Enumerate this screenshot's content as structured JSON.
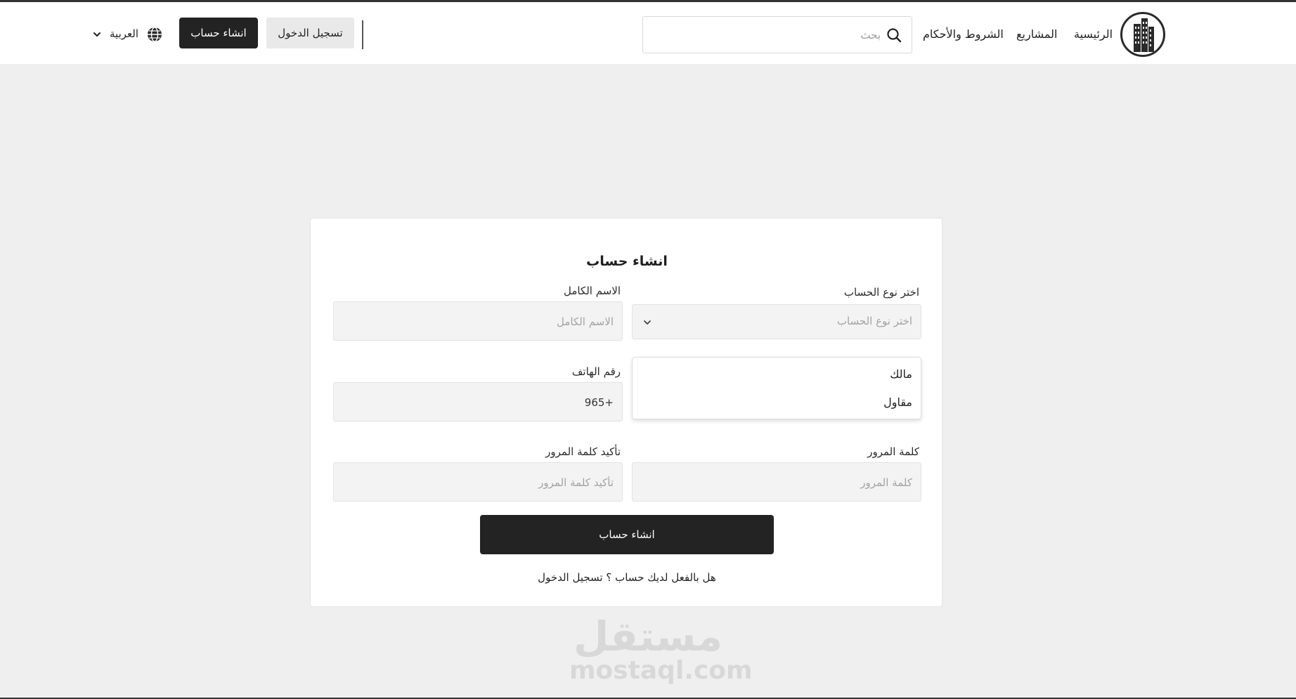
{
  "nav": {
    "links": [
      "الرئيسية",
      "المشاريع",
      "الشروط والأحكام"
    ],
    "search_placeholder": "بحث",
    "login_label": "تسجيل الدخول",
    "signup_label": "انشاء حساب",
    "language_label": "العربية"
  },
  "form": {
    "title": "انشاء حساب",
    "account_type": {
      "label": "اختر نوع الحساب",
      "placeholder": "اختر نوع الحساب",
      "options": [
        "مالك",
        "مقاول"
      ]
    },
    "full_name": {
      "label": "الاسم الكامل",
      "placeholder": "الاسم الكامل"
    },
    "phone": {
      "label": "رقم الهاتف",
      "value": "+965"
    },
    "password": {
      "label": "كلمة المرور",
      "placeholder": "كلمة المرور"
    },
    "confirm_password": {
      "label": "تأكيد كلمة المرور",
      "placeholder": "تأكيد كلمة المرور"
    },
    "submit_label": "انشاء حساب",
    "already_prompt": "هل بالفعل لديك حساب ؟",
    "already_link": "تسجيل الدخول"
  },
  "watermark": {
    "arabic": "مستقل",
    "latin": "mostaql.com"
  },
  "colors": {
    "page_bg": "#efefef",
    "primary_dark": "#232323",
    "card_bg": "#ffffff",
    "input_bg": "#f3f3f3"
  },
  "icons": [
    "building-logo-icon",
    "search-icon",
    "globe-icon",
    "chevron-down-icon"
  ]
}
